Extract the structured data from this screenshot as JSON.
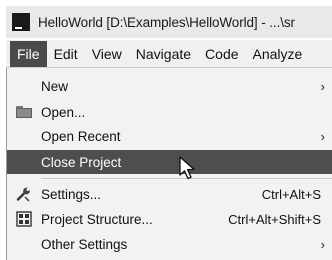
{
  "window": {
    "title": "HelloWorld [D:\\Examples\\HelloWorld] - ...\\sr",
    "app_icon_letter": "IJ"
  },
  "menubar": {
    "items": [
      {
        "label": "File"
      },
      {
        "label": "Edit"
      },
      {
        "label": "View"
      },
      {
        "label": "Navigate"
      },
      {
        "label": "Code"
      },
      {
        "label": "Analyze"
      }
    ]
  },
  "file_menu": {
    "new": {
      "label": "New",
      "arrow": "›"
    },
    "open": {
      "label": "Open..."
    },
    "open_recent": {
      "label": "Open Recent",
      "arrow": "›"
    },
    "close_project": {
      "label": "Close Project"
    },
    "settings": {
      "label": "Settings...",
      "shortcut": "Ctrl+Alt+S"
    },
    "project_structure": {
      "label": "Project Structure...",
      "shortcut": "Ctrl+Alt+Shift+S"
    },
    "other_settings": {
      "label": "Other Settings",
      "arrow": "›"
    }
  }
}
